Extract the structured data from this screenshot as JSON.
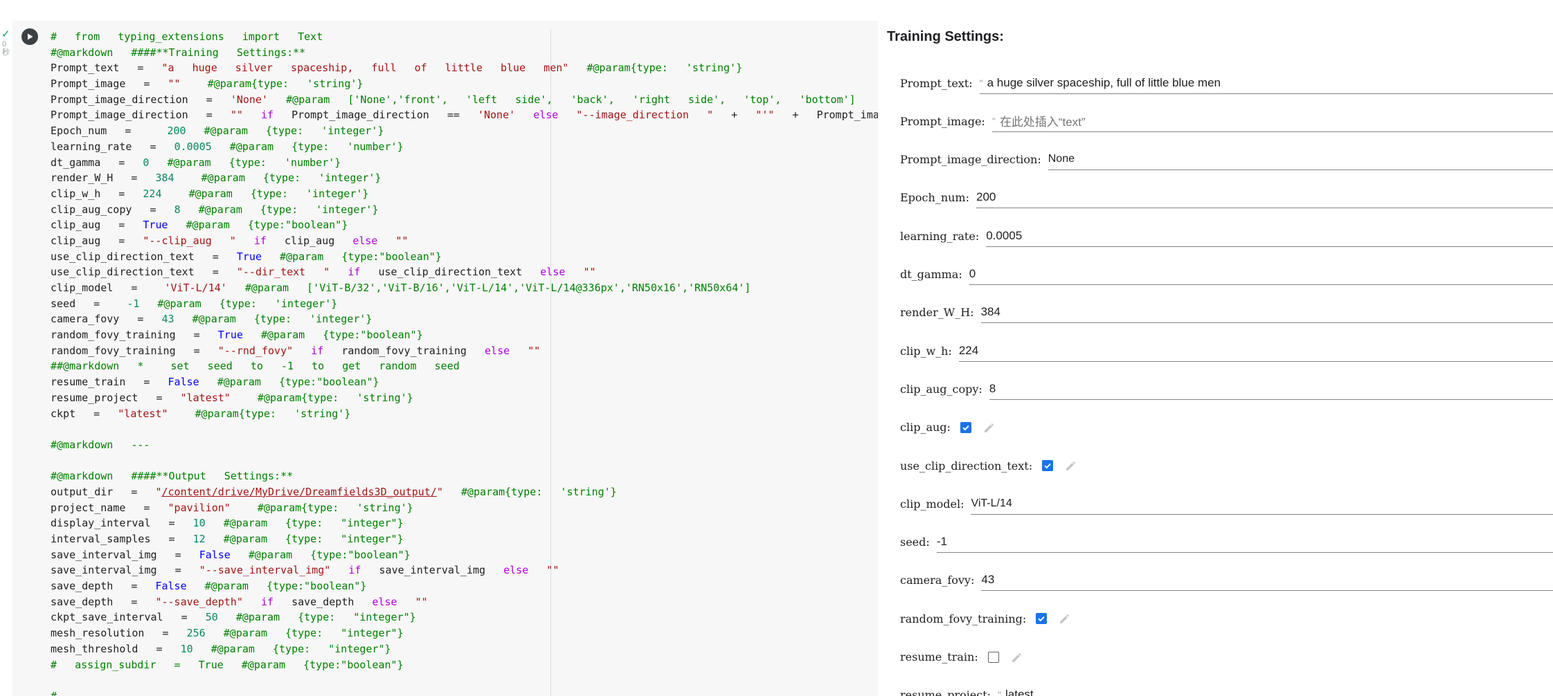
{
  "cell": {
    "exec_count": "0\n秒",
    "code_lines": [
      [
        [
          "c",
          "#  from  typing_extensions  import  Text"
        ]
      ],
      [
        [
          "c",
          "#@markdown  ####**Training  Settings:**"
        ]
      ],
      [
        [
          "",
          "Prompt_text  =  "
        ],
        [
          "s",
          "\"a  huge  silver  spaceship,  full  of  little  blue  men\""
        ],
        [
          "c",
          "  #@param{type:  'string'}"
        ]
      ],
      [
        [
          "",
          "Prompt_image  =  "
        ],
        [
          "s",
          "\"\""
        ],
        [
          "c",
          "   #@param{type:  'string'}"
        ]
      ],
      [
        [
          "",
          "Prompt_image_direction  =  "
        ],
        [
          "s",
          "'None'"
        ],
        [
          "c",
          "  #@param  ['None','front',  'left  side',  'back',  'right  side',  'top',  'bottom']"
        ]
      ],
      [
        [
          "",
          "Prompt_image_direction  =  "
        ],
        [
          "s",
          "\"\""
        ],
        [
          "",
          ""
        ],
        [
          "kw",
          "  if"
        ],
        [
          "",
          "  Prompt_image_direction  ==  "
        ],
        [
          "s",
          "'None'"
        ],
        [
          "kw",
          "  else"
        ],
        [
          "s",
          "  \"--image_direction  \""
        ],
        [
          "",
          "  +  "
        ],
        [
          "s",
          "\"'\""
        ],
        [
          "",
          "  +  Prompt_image_direction"
        ]
      ],
      [
        [
          "",
          "Epoch_num  =    "
        ],
        [
          "n",
          "200"
        ],
        [
          "c",
          "  #@param  {type:  'integer'}"
        ]
      ],
      [
        [
          "",
          "learning_rate  =  "
        ],
        [
          "n",
          "0.0005"
        ],
        [
          "c",
          "  #@param  {type:  'number'}"
        ]
      ],
      [
        [
          "",
          "dt_gamma  =  "
        ],
        [
          "n",
          "0"
        ],
        [
          "c",
          "  #@param  {type:  'number'}"
        ]
      ],
      [
        [
          "",
          "render_W_H  =  "
        ],
        [
          "n",
          "384"
        ],
        [
          "c",
          "   #@param  {type:  'integer'}"
        ]
      ],
      [
        [
          "",
          "clip_w_h  =  "
        ],
        [
          "n",
          "224"
        ],
        [
          "c",
          "   #@param  {type:  'integer'}"
        ]
      ],
      [
        [
          "",
          "clip_aug_copy  =  "
        ],
        [
          "n",
          "8"
        ],
        [
          "c",
          "  #@param  {type:  'integer'}"
        ]
      ],
      [
        [
          "",
          "clip_aug  =  "
        ],
        [
          "b",
          "True"
        ],
        [
          "c",
          "  #@param  {type:\"boolean\"}"
        ]
      ],
      [
        [
          "",
          "clip_aug  =  "
        ],
        [
          "s",
          "\"--clip_aug  \""
        ],
        [
          "kw",
          "  if"
        ],
        [
          "",
          "  clip_aug"
        ],
        [
          "kw",
          "  else"
        ],
        [
          "s",
          "  \"\""
        ]
      ],
      [
        [
          "",
          "use_clip_direction_text  =  "
        ],
        [
          "b",
          "True"
        ],
        [
          "c",
          "  #@param  {type:\"boolean\"}"
        ]
      ],
      [
        [
          "",
          "use_clip_direction_text  =  "
        ],
        [
          "s",
          "\"--dir_text  \""
        ],
        [
          "kw",
          "  if"
        ],
        [
          "",
          "  use_clip_direction_text"
        ],
        [
          "kw",
          "  else"
        ],
        [
          "s",
          "  \"\""
        ]
      ],
      [
        [
          "",
          "clip_model  =   "
        ],
        [
          "s",
          "'ViT-L/14'"
        ],
        [
          "c",
          "  #@param  ['ViT-B/32','ViT-B/16','ViT-L/14','ViT-L/14@336px','RN50x16','RN50x64']"
        ]
      ],
      [
        [
          "",
          "seed  =   "
        ],
        [
          "n",
          "-1"
        ],
        [
          "c",
          "  #@param  {type:  'integer'}"
        ]
      ],
      [
        [
          "",
          "camera_fovy  =  "
        ],
        [
          "n",
          "43"
        ],
        [
          "c",
          "  #@param  {type:  'integer'}"
        ]
      ],
      [
        [
          "",
          "random_fovy_training  =  "
        ],
        [
          "b",
          "True"
        ],
        [
          "c",
          "  #@param  {type:\"boolean\"}"
        ]
      ],
      [
        [
          "",
          "random_fovy_training  =  "
        ],
        [
          "s",
          "\"--rnd_fovy\""
        ],
        [
          "kw",
          "  if"
        ],
        [
          "",
          "  random_fovy_training"
        ],
        [
          "kw",
          "  else"
        ],
        [
          "s",
          "  \"\""
        ]
      ],
      [
        [
          "c",
          "##@markdown  *   set  seed  to  -1  to  get  random  seed"
        ]
      ],
      [
        [
          "",
          "resume_train  =  "
        ],
        [
          "b",
          "False"
        ],
        [
          "c",
          "  #@param  {type:\"boolean\"}"
        ]
      ],
      [
        [
          "",
          "resume_project  =  "
        ],
        [
          "s",
          "\"latest\""
        ],
        [
          "c",
          "   #@param{type:  'string'}"
        ]
      ],
      [
        [
          "",
          "ckpt  =  "
        ],
        [
          "s",
          "\"latest\""
        ],
        [
          "c",
          "   #@param{type:  'string'}"
        ]
      ],
      [],
      [
        [
          "c",
          "#@markdown  ---"
        ]
      ],
      [],
      [
        [
          "c",
          "#@markdown  ####**Output  Settings:**"
        ]
      ],
      [
        [
          "",
          "output_dir  =  "
        ],
        [
          "s",
          "\""
        ],
        [
          "u",
          "/content/drive/MyDrive/Dreamfields3D_output/"
        ],
        [
          "s",
          "\""
        ],
        [
          "c",
          "  #@param{type:  'string'}"
        ]
      ],
      [
        [
          "",
          "project_name  =  "
        ],
        [
          "s",
          "\"pavilion\""
        ],
        [
          "c",
          "   #@param{type:  'string'}"
        ]
      ],
      [
        [
          "",
          "display_interval  =  "
        ],
        [
          "n",
          "10"
        ],
        [
          "c",
          "  #@param  {type:  \"integer\"}"
        ]
      ],
      [
        [
          "",
          "interval_samples  =  "
        ],
        [
          "n",
          "12"
        ],
        [
          "c",
          "  #@param  {type:  \"integer\"}"
        ]
      ],
      [
        [
          "",
          "save_interval_img  =  "
        ],
        [
          "b",
          "False"
        ],
        [
          "c",
          "  #@param  {type:\"boolean\"}"
        ]
      ],
      [
        [
          "",
          "save_interval_img  =  "
        ],
        [
          "s",
          "\"--save_interval_img\""
        ],
        [
          "kw",
          "  if"
        ],
        [
          "",
          "  save_interval_img"
        ],
        [
          "kw",
          "  else"
        ],
        [
          "s",
          "  \"\""
        ]
      ],
      [
        [
          "",
          "save_depth  =  "
        ],
        [
          "b",
          "False"
        ],
        [
          "c",
          "  #@param  {type:\"boolean\"}"
        ]
      ],
      [
        [
          "",
          "save_depth  =  "
        ],
        [
          "s",
          "\"--save_depth\""
        ],
        [
          "kw",
          "  if"
        ],
        [
          "",
          "  save_depth"
        ],
        [
          "kw",
          "  else"
        ],
        [
          "s",
          "  \"\""
        ]
      ],
      [
        [
          "",
          "ckpt_save_interval  =  "
        ],
        [
          "n",
          "50"
        ],
        [
          "c",
          "  #@param  {type:  \"integer\"}"
        ]
      ],
      [
        [
          "",
          "mesh_resolution  =  "
        ],
        [
          "n",
          "256"
        ],
        [
          "c",
          "  #@param  {type:  \"integer\"}"
        ]
      ],
      [
        [
          "",
          "mesh_threshold  =  "
        ],
        [
          "n",
          "10"
        ],
        [
          "c",
          "  #@param  {type:  \"integer\"}"
        ]
      ],
      [
        [
          "c",
          "#  assign_subdir  =  True  #@param  {type:\"boolean\"}"
        ]
      ],
      [],
      [
        [
          "c",
          "#"
        ]
      ]
    ]
  },
  "form": {
    "title": "Training Settings:",
    "rows": [
      {
        "kind": "text",
        "label": "Prompt_text:",
        "value": "a huge silver spaceship, full of little blue men",
        "quote": "\""
      },
      {
        "kind": "text",
        "label": "Prompt_image:",
        "placeholder": "在此处插入“text”",
        "quote": "\""
      },
      {
        "kind": "select",
        "label": "Prompt_image_direction:",
        "value": "None"
      },
      {
        "kind": "text",
        "label": "Epoch_num:",
        "value": "200"
      },
      {
        "kind": "text",
        "label": "learning_rate:",
        "value": "0.0005"
      },
      {
        "kind": "text",
        "label": "dt_gamma:",
        "value": "0"
      },
      {
        "kind": "text",
        "label": "render_W_H:",
        "value": "384"
      },
      {
        "kind": "text",
        "label": "clip_w_h:",
        "value": "224"
      },
      {
        "kind": "text",
        "label": "clip_aug_copy:",
        "value": "8"
      },
      {
        "kind": "check",
        "label": "clip_aug:",
        "checked": true
      },
      {
        "kind": "check",
        "label": "use_clip_direction_text:",
        "checked": true
      },
      {
        "kind": "select",
        "label": "clip_model:",
        "value": "ViT-L/14"
      },
      {
        "kind": "text",
        "label": "seed:",
        "value": "-1"
      },
      {
        "kind": "text",
        "label": "camera_fovy:",
        "value": "43"
      },
      {
        "kind": "check",
        "label": "random_fovy_training:",
        "checked": true
      },
      {
        "kind": "check",
        "label": "resume_train:",
        "checked": false
      },
      {
        "kind": "text",
        "label": "resume_project:",
        "value": "latest",
        "quote": "\""
      }
    ]
  },
  "icons": {
    "status": "check-icon",
    "run": "play-icon",
    "edit": "pencil-icon"
  },
  "colors": {
    "checkbox_checked": "#1a73e8",
    "code_background": "#f7f7f7",
    "run_button": "#3c4043"
  }
}
